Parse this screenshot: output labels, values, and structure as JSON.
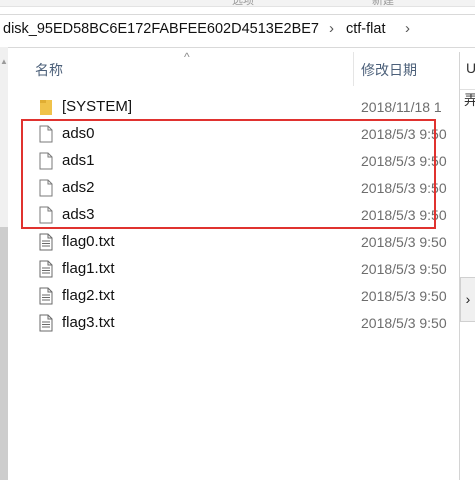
{
  "ribbon": {
    "labels": [
      "选项",
      "新建"
    ]
  },
  "address": {
    "segments": [
      "disk_95ED58BC6E172FABFEE602D4513E2BE7",
      "ctf-flat"
    ]
  },
  "header": {
    "name_label": "名称",
    "date_label": "修改日期"
  },
  "right_pane": {
    "top_label": "U",
    "second_label": "弄"
  },
  "files": [
    {
      "name": "[SYSTEM]",
      "type": "folder",
      "date": "2018/11/18 1"
    },
    {
      "name": "ads0",
      "type": "file",
      "date": "2018/5/3 9:50"
    },
    {
      "name": "ads1",
      "type": "file",
      "date": "2018/5/3 9:50"
    },
    {
      "name": "ads2",
      "type": "file",
      "date": "2018/5/3 9:50"
    },
    {
      "name": "ads3",
      "type": "file",
      "date": "2018/5/3 9:50"
    },
    {
      "name": "flag0.txt",
      "type": "text-file",
      "date": "2018/5/3 9:50"
    },
    {
      "name": "flag1.txt",
      "type": "text-file",
      "date": "2018/5/3 9:50"
    },
    {
      "name": "flag2.txt",
      "type": "text-file",
      "date": "2018/5/3 9:50"
    },
    {
      "name": "flag3.txt",
      "type": "text-file",
      "date": "2018/5/3 9:50"
    }
  ],
  "colors": {
    "highlight": "#e0322f",
    "folder": "#f0c24a",
    "header_text": "#4c607a"
  }
}
